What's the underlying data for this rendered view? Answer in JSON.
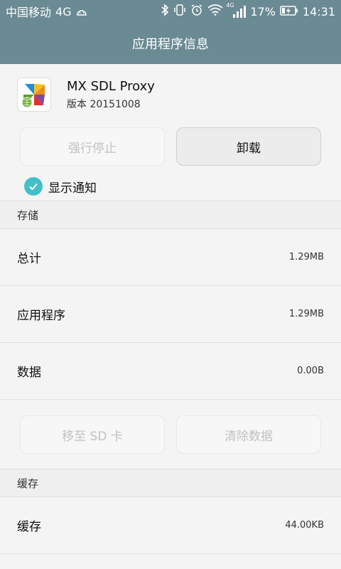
{
  "status_bar": {
    "carrier": "中国移动",
    "network": "4G",
    "signal_type": "4G",
    "battery": "17%",
    "time": "14:31",
    "icons": [
      "android-icon",
      "bluetooth-icon",
      "vibrate-icon",
      "alarm-icon",
      "wifi-icon",
      "signal-icon",
      "battery-charging-icon"
    ]
  },
  "header": {
    "title": "应用程序信息"
  },
  "app": {
    "name": "MX SDL Proxy",
    "version": "版本 20151008",
    "icon": "pinwheel-icon"
  },
  "actions": {
    "force_stop": "强行停止",
    "uninstall": "卸载"
  },
  "notification": {
    "label": "显示通知",
    "checked": true
  },
  "storage": {
    "header": "存储",
    "rows": [
      {
        "label": "总计",
        "value": "1.29MB"
      },
      {
        "label": "应用程序",
        "value": "1.29MB"
      },
      {
        "label": "数据",
        "value": "0.00B"
      }
    ],
    "move_sd": "移至 SD 卡",
    "clear_data": "清除数据"
  },
  "cache": {
    "header": "缓存",
    "rows": [
      {
        "label": "缓存",
        "value": "44.00KB"
      }
    ]
  },
  "colors": {
    "header_bg": "#6a8a94",
    "accent": "#43bfc9"
  }
}
